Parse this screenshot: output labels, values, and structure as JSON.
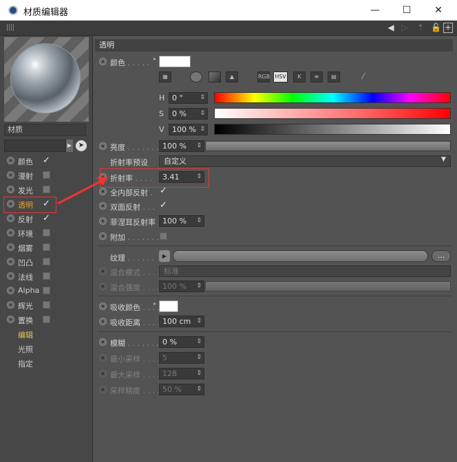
{
  "window": {
    "title": "材质编辑器",
    "minimize": "—",
    "maximize": "☐",
    "close": "✕"
  },
  "left": {
    "material_name": "材质",
    "channels": [
      {
        "label": "颜色",
        "checked": true
      },
      {
        "label": "漫射",
        "checked": false
      },
      {
        "label": "发光",
        "checked": false
      },
      {
        "label": "透明",
        "checked": true,
        "selected": true
      },
      {
        "label": "反射",
        "checked": true
      },
      {
        "label": "环境",
        "checked": false
      },
      {
        "label": "烟雾",
        "checked": false
      },
      {
        "label": "凹凸",
        "checked": false
      },
      {
        "label": "法线",
        "checked": false
      },
      {
        "label": "Alpha",
        "checked": false
      },
      {
        "label": "辉光",
        "checked": false
      },
      {
        "label": "置换",
        "checked": false
      }
    ],
    "extras": [
      "编辑",
      "光照",
      "指定"
    ]
  },
  "section": {
    "title": "透明"
  },
  "color": {
    "label": "颜色",
    "swatch": "#ffffff",
    "h_label": "H",
    "h_value": "0 °",
    "s_label": "S",
    "s_value": "0 %",
    "v_label": "V",
    "v_value": "100 %",
    "icons": [
      "RGB",
      "HSV",
      "K"
    ]
  },
  "brightness": {
    "label": "亮度",
    "value": "100 %"
  },
  "ior_preset": {
    "label": "折射率预设",
    "value": "自定义"
  },
  "ior": {
    "label": "折射率",
    "value": "3.41"
  },
  "total_internal": {
    "label": "全内部反射"
  },
  "double_sided": {
    "label": "双面反射"
  },
  "fresnel": {
    "label": "菲涅耳反射率",
    "value": "100 %"
  },
  "additive": {
    "label": "附加"
  },
  "texture": {
    "label": "纹理",
    "more": "..."
  },
  "blend_mode": {
    "label": "混合模式",
    "value": "标准"
  },
  "blend_strength": {
    "label": "混合强度",
    "value": "100 %"
  },
  "absorption_color": {
    "label": "吸收颜色"
  },
  "absorption_distance": {
    "label": "吸收距离",
    "value": "100 cm"
  },
  "blur": {
    "label": "模糊",
    "value": "0 %"
  },
  "min_samples": {
    "label": "最小采样",
    "value": "5"
  },
  "max_samples": {
    "label": "最大采样",
    "value": "128"
  },
  "sample_accuracy": {
    "label": "采样精度",
    "value": "50 %"
  }
}
